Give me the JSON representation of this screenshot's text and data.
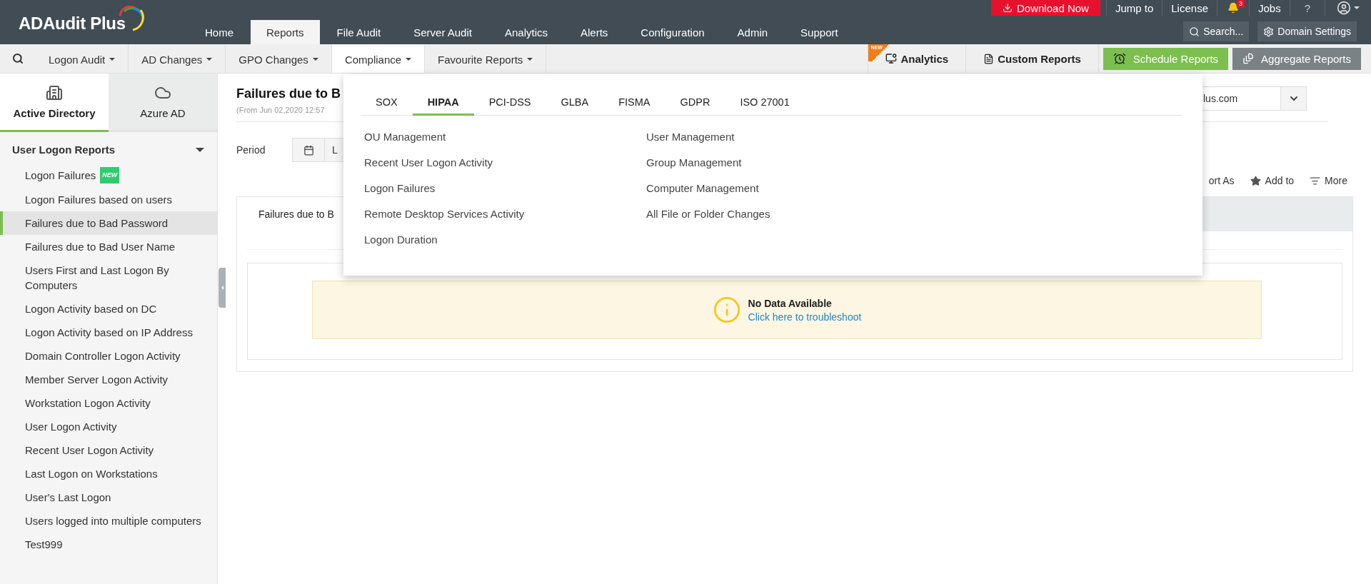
{
  "header": {
    "logo": "ADAudit Plus",
    "download": "Download Now",
    "links": [
      "Jump to",
      "License"
    ],
    "notification_count": "3",
    "jobs": "Jobs",
    "help": "?",
    "nav": [
      {
        "label": "Home",
        "selected": false
      },
      {
        "label": "Reports",
        "selected": true
      },
      {
        "label": "File Audit",
        "selected": false
      },
      {
        "label": "Server Audit",
        "selected": false
      },
      {
        "label": "Analytics",
        "selected": false
      },
      {
        "label": "Alerts",
        "selected": false
      },
      {
        "label": "Configuration",
        "selected": false
      },
      {
        "label": "Admin",
        "selected": false
      },
      {
        "label": "Support",
        "selected": false
      }
    ],
    "search": "Search...",
    "domain_settings": "Domain Settings"
  },
  "menubar": {
    "menus": [
      {
        "label": "Logon Audit",
        "selected": false
      },
      {
        "label": "AD Changes",
        "selected": false
      },
      {
        "label": "GPO Changes",
        "selected": false
      },
      {
        "label": "Compliance",
        "selected": true
      },
      {
        "label": "Favourite Reports",
        "selected": false
      }
    ],
    "analytics": {
      "label": "Analytics",
      "badge": "NEW"
    },
    "custom_reports": "Custom Reports",
    "schedule_reports": "Schedule Reports",
    "aggregate_reports": "Aggregate Reports"
  },
  "sidebar": {
    "tabs": [
      {
        "label": "Active Directory",
        "kind": "building",
        "selected": true
      },
      {
        "label": "Azure AD",
        "kind": "cloud",
        "selected": false
      }
    ],
    "group": {
      "title": "User Logon Reports",
      "expanded": true,
      "items": [
        {
          "label": "Logon Failures",
          "badge": "NEW",
          "selected": false
        },
        {
          "label": "Logon Failures based on users",
          "selected": false
        },
        {
          "label": "Failures due to Bad Password",
          "selected": true
        },
        {
          "label": "Failures due to Bad User Name",
          "selected": false
        },
        {
          "label": "Users First and Last Logon By Computers",
          "selected": false
        },
        {
          "label": "Logon Activity based on DC",
          "selected": false
        },
        {
          "label": "Logon Activity based on IP Address",
          "selected": false
        },
        {
          "label": "Domain Controller Logon Activity",
          "selected": false
        },
        {
          "label": "Member Server Logon Activity",
          "selected": false
        },
        {
          "label": "Workstation Logon Activity",
          "selected": false
        },
        {
          "label": "User Logon Activity",
          "selected": false
        },
        {
          "label": "Recent User Logon Activity",
          "selected": false
        },
        {
          "label": "Last Logon on Workstations",
          "selected": false
        },
        {
          "label": "User's Last Logon",
          "selected": false
        },
        {
          "label": "Users logged into multiple computers",
          "selected": false
        },
        {
          "label": "Test999",
          "selected": false
        }
      ]
    }
  },
  "report": {
    "title": "Failures due to B",
    "subtitle": "(From Jun 02,2020 12:57",
    "period_label": "Period",
    "period_value": "L",
    "domain": "lus.com",
    "actions": [
      {
        "label": "ort As",
        "kind": "export"
      },
      {
        "label": "Add to",
        "kind": "favourite"
      },
      {
        "label": "More",
        "kind": "more"
      }
    ],
    "tab": "Failures due to B",
    "message": {
      "title": "No Data Available",
      "link": "Click here to troubleshoot"
    }
  },
  "compliance_menu": {
    "tabs": [
      {
        "label": "SOX",
        "selected": false
      },
      {
        "label": "HIPAA",
        "selected": true
      },
      {
        "label": "PCI-DSS",
        "selected": false
      },
      {
        "label": "GLBA",
        "selected": false
      },
      {
        "label": "FISMA",
        "selected": false
      },
      {
        "label": "GDPR",
        "selected": false
      },
      {
        "label": "ISO 27001",
        "selected": false
      }
    ],
    "columns": [
      [
        "OU Management",
        "Recent User Logon Activity",
        "Logon Failures",
        "Remote Desktop Services Activity",
        "Logon Duration"
      ],
      [
        "User Management",
        "Group Management",
        "Computer Management",
        "All File or Folder Changes"
      ]
    ]
  }
}
